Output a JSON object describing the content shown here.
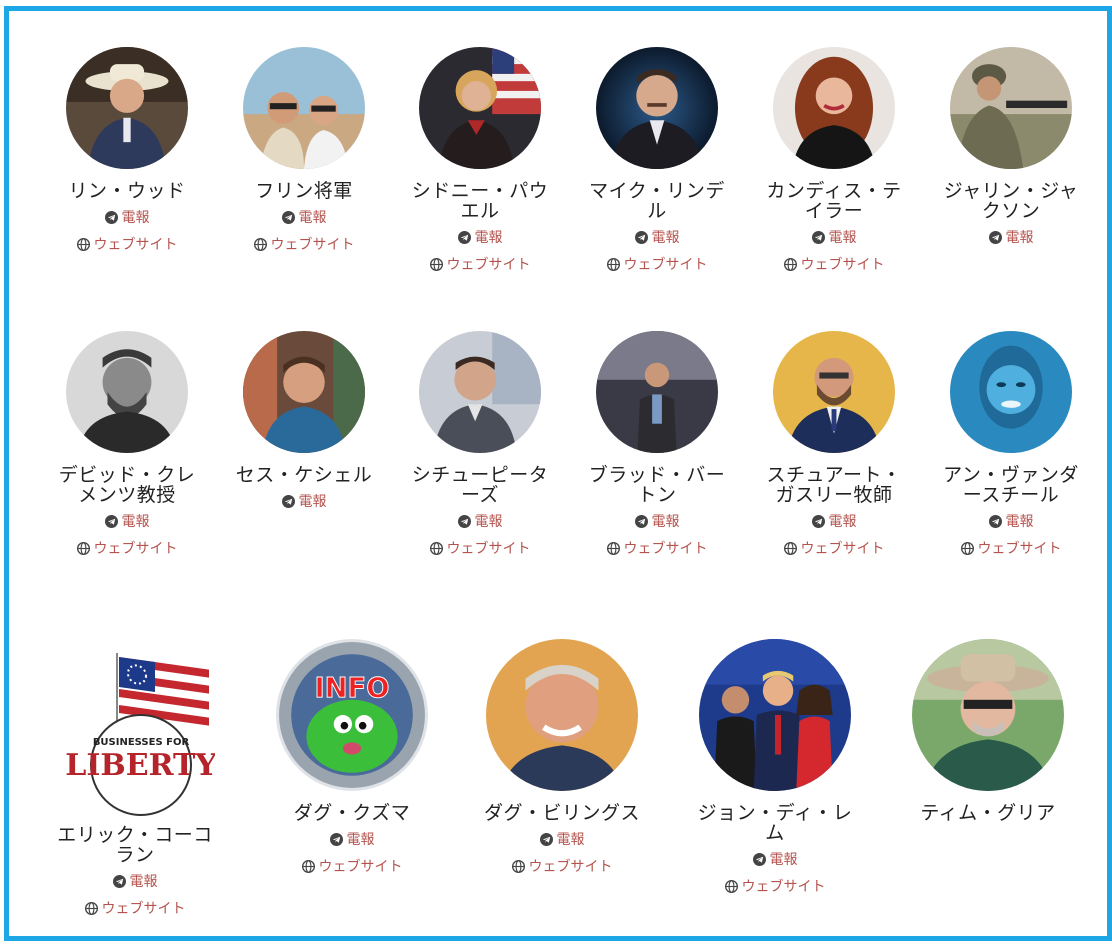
{
  "accent_color": "#b5544e",
  "border_color": "#1ea7e6",
  "links": {
    "telegram": "電報",
    "website": "ウェブサイト"
  },
  "people": [
    {
      "name": "リン・ウッド",
      "telegram": true,
      "website": true
    },
    {
      "name": "フリン将軍",
      "telegram": true,
      "website": true
    },
    {
      "name": "シドニー・パウエル",
      "telegram": true,
      "website": true
    },
    {
      "name": "マイク・リンデル",
      "telegram": true,
      "website": true
    },
    {
      "name": "カンディス・テイラー",
      "telegram": true,
      "website": true
    },
    {
      "name": "ジャリン・ジャクソン",
      "telegram": true,
      "website": false
    },
    {
      "name": "デビッド・クレメンツ教授",
      "telegram": true,
      "website": true
    },
    {
      "name": "セス・ケシェル",
      "telegram": true,
      "website": false
    },
    {
      "name": "シチューピーターズ",
      "telegram": true,
      "website": true
    },
    {
      "name": "ブラッド・バートン",
      "telegram": true,
      "website": true
    },
    {
      "name": "スチュアート・ガスリー牧師",
      "telegram": true,
      "website": true
    },
    {
      "name": "アン・ヴァンダースチール",
      "telegram": true,
      "website": true
    },
    {
      "name": "エリック・コーコラン",
      "telegram": true,
      "website": true,
      "logo_text": "BUSINESSES FOR LIBERTY"
    },
    {
      "name": "ダグ・クズマ",
      "telegram": true,
      "website": true,
      "logo_text": "INFO"
    },
    {
      "name": "ダグ・ビリングス",
      "telegram": true,
      "website": true
    },
    {
      "name": "ジョン・ディ・レム",
      "telegram": true,
      "website": true
    },
    {
      "name": "ティム・グリア",
      "telegram": false,
      "website": false
    }
  ]
}
